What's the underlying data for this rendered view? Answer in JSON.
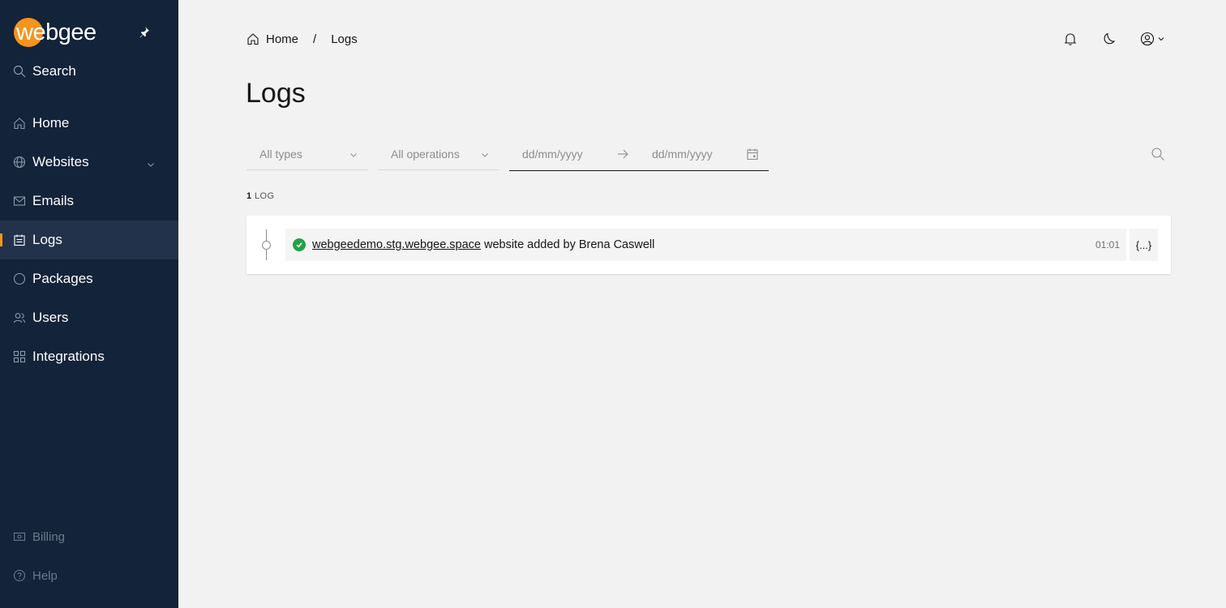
{
  "app": {
    "logo_text": "webgee",
    "colors": {
      "sidebar_bg": "#13233a",
      "accent": "#f6941d",
      "success": "#24a148"
    }
  },
  "sidebar": {
    "search_label": "Search",
    "items": [
      {
        "label": "Home",
        "icon": "home-icon"
      },
      {
        "label": "Websites",
        "icon": "globe-icon",
        "expandable": true
      },
      {
        "label": "Emails",
        "icon": "mail-icon"
      },
      {
        "label": "Logs",
        "icon": "logs-icon",
        "active": true
      },
      {
        "label": "Packages",
        "icon": "packages-icon"
      },
      {
        "label": "Users",
        "icon": "users-icon"
      },
      {
        "label": "Integrations",
        "icon": "integrations-icon"
      }
    ],
    "bottom": [
      {
        "label": "Billing",
        "icon": "billing-icon"
      },
      {
        "label": "Help",
        "icon": "help-icon"
      }
    ]
  },
  "breadcrumb": {
    "home": "Home",
    "separator": "/",
    "current": "Logs"
  },
  "page": {
    "title": "Logs"
  },
  "filters": {
    "type_placeholder": "All types",
    "operation_placeholder": "All operations",
    "date_from_placeholder": "dd/mm/yyyy",
    "date_to_placeholder": "dd/mm/yyyy"
  },
  "logs": {
    "count": "1",
    "count_label": "LOG",
    "entries": [
      {
        "status": "success",
        "link_text": "webgeedemo.stg.webgee.space",
        "message": "website added by Brena Caswell",
        "time": "01:01",
        "details_label": "{...}"
      }
    ]
  }
}
